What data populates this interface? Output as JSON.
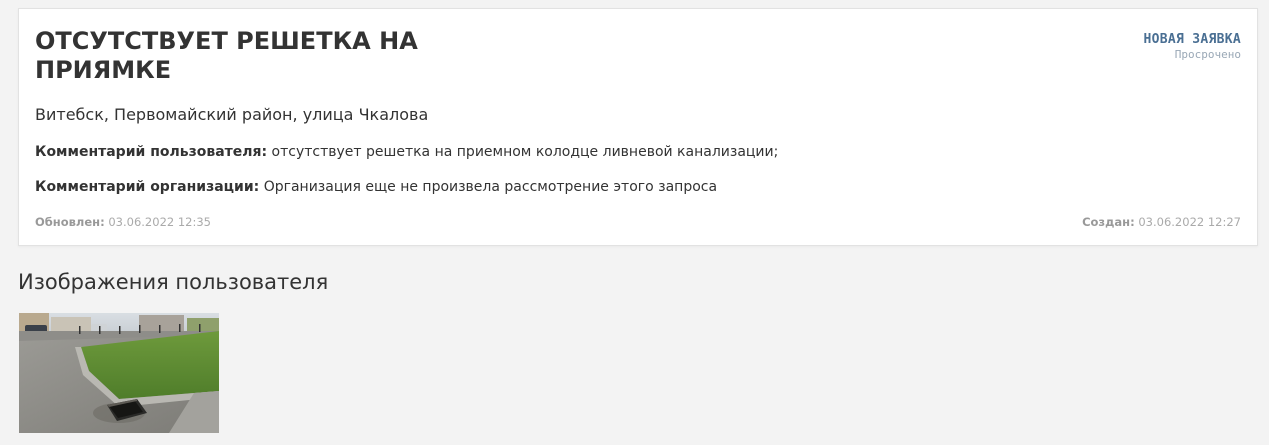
{
  "request": {
    "title": "ОТСУТСТВУЕТ РЕШЕТКА НА ПРИЯМКЕ",
    "status": "НОВАЯ ЗАЯВКА",
    "status_sub": "Просрочено",
    "address": "Витебск, Первомайский район, улица Чкалова",
    "user_comment_label": "Комментарий пользователя:",
    "user_comment": " отсутствует решетка на приемном колодце ливневой канализации;",
    "org_comment_label": "Комментарий организации:",
    "org_comment": " Организация еще не произвела рассмотрение этого запроса",
    "updated_label": "Обновлен:",
    "updated_value": " 03.06.2022 12:35",
    "created_label": "Создан:",
    "created_value": " 03.06.2022 12:27"
  },
  "images_section": {
    "title": "Изображения пользователя"
  },
  "colors": {
    "status": "#4a6f93",
    "background": "#f3f3f3"
  }
}
